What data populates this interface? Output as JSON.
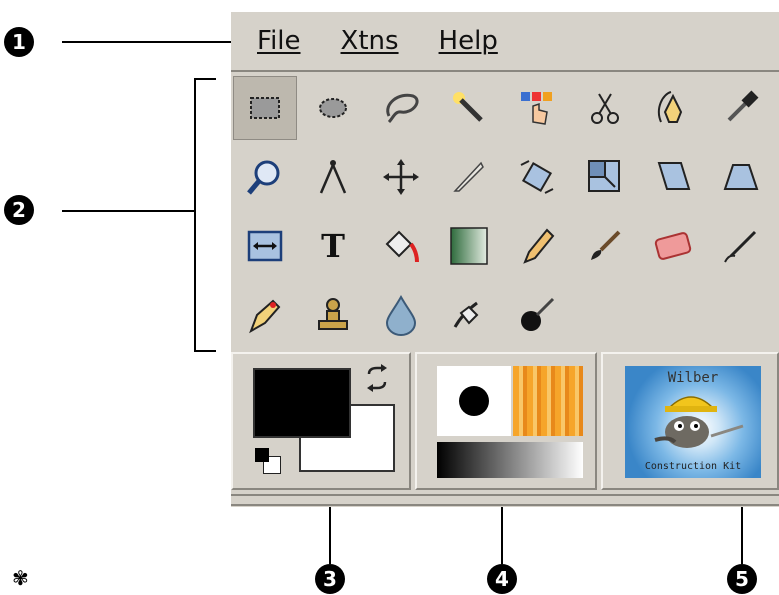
{
  "callouts": [
    "1",
    "2",
    "3",
    "4",
    "5"
  ],
  "menu": {
    "items": [
      {
        "label": "File",
        "underline": "F"
      },
      {
        "label": "Xtns",
        "underline": "X"
      },
      {
        "label": "Help",
        "underline": "H"
      }
    ]
  },
  "tools": [
    {
      "icon": "rect-select-icon"
    },
    {
      "icon": "ellipse-select-icon"
    },
    {
      "icon": "free-select-icon"
    },
    {
      "icon": "fuzzy-select-icon"
    },
    {
      "icon": "color-select-icon"
    },
    {
      "icon": "scissors-icon"
    },
    {
      "icon": "paths-icon"
    },
    {
      "icon": "color-picker-icon"
    },
    {
      "icon": "zoom-icon"
    },
    {
      "icon": "measure-icon"
    },
    {
      "icon": "move-icon"
    },
    {
      "icon": "crop-icon"
    },
    {
      "icon": "rotate-icon"
    },
    {
      "icon": "scale-icon"
    },
    {
      "icon": "shear-icon"
    },
    {
      "icon": "perspective-icon"
    },
    {
      "icon": "flip-icon"
    },
    {
      "icon": "text-icon",
      "label": "T"
    },
    {
      "icon": "bucket-fill-icon"
    },
    {
      "icon": "blend-icon"
    },
    {
      "icon": "pencil-icon"
    },
    {
      "icon": "paintbrush-icon"
    },
    {
      "icon": "eraser-icon"
    },
    {
      "icon": "airbrush-icon"
    },
    {
      "icon": "ink-icon"
    },
    {
      "icon": "clone-icon"
    },
    {
      "icon": "blur-icon"
    },
    {
      "icon": "smudge-icon"
    },
    {
      "icon": "dodge-burn-icon"
    }
  ],
  "colors": {
    "foreground": "#000000",
    "background": "#ffffff",
    "chrome": "#d6d2ca",
    "gradient_start": "#2e6b3c",
    "gradient_end": "#e4ece2"
  },
  "image_panel": {
    "top_text": "Wilber",
    "bottom_text": "Construction Kit"
  },
  "corner_glyph": "✾"
}
